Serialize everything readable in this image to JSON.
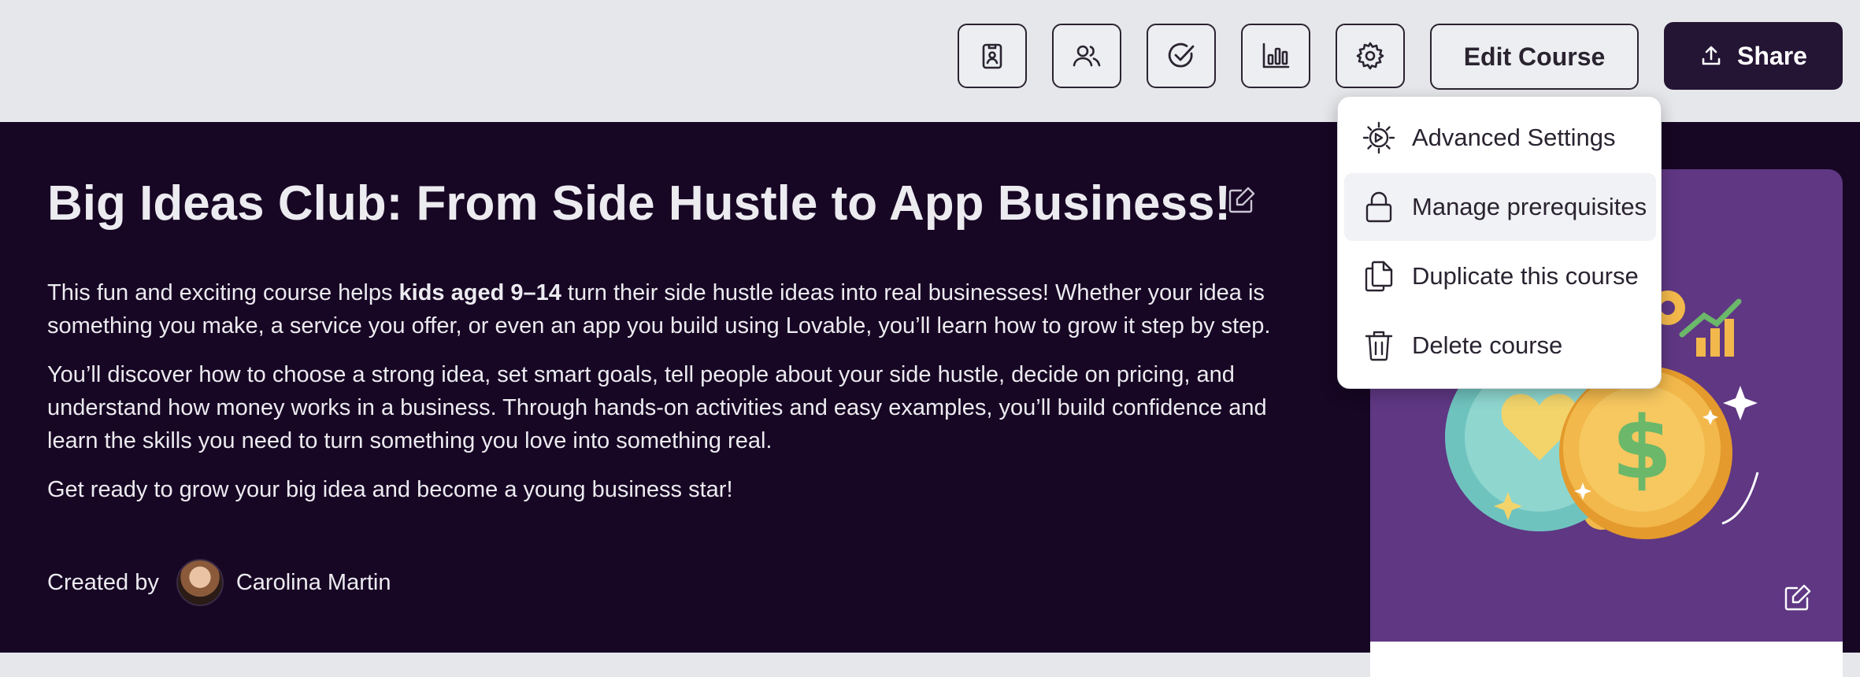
{
  "toolbar": {
    "icon_buttons": [
      {
        "icon": "id-badge-icon"
      },
      {
        "icon": "users-icon"
      },
      {
        "icon": "check-circle-icon"
      },
      {
        "icon": "bar-chart-icon"
      },
      {
        "icon": "gear-icon"
      }
    ],
    "edit_label": "Edit Course",
    "share_label": "Share"
  },
  "dropdown": {
    "items": [
      {
        "label": "Advanced Settings",
        "icon": "advanced-gear-icon"
      },
      {
        "label": "Manage prerequisites",
        "icon": "lock-icon"
      },
      {
        "label": "Duplicate this course",
        "icon": "duplicate-icon"
      },
      {
        "label": "Delete course",
        "icon": "trash-icon"
      }
    ]
  },
  "course": {
    "title": "Big Ideas Club: From Side Hustle to App Business!",
    "p1_before": "This fun and exciting course helps ",
    "p1_bold": "kids aged 9–14",
    "p1_after": " turn their side hustle ideas into real businesses! Whether your idea is something you make, a service you offer, or even an app you build using Lovable, you’ll learn how to grow it step by step.",
    "p2": "You’ll discover how to choose a strong idea, set smart goals, tell people about your side hustle, decide on pricing, and understand how money works in a business. Through hands-on activities and easy examples, you’ll build confidence and learn the skills you need to turn something you love into something real.",
    "p3": "Get ready to grow your big idea and become a young business star!",
    "created_by_label": "Created by",
    "author": "Carolina Martin"
  },
  "colors": {
    "hero_bg": "#170624",
    "share_bg": "#241534",
    "thumb_bg": "#5f3783",
    "coin_gold": "#f2b84b",
    "coin_green": "#6bb86a"
  }
}
